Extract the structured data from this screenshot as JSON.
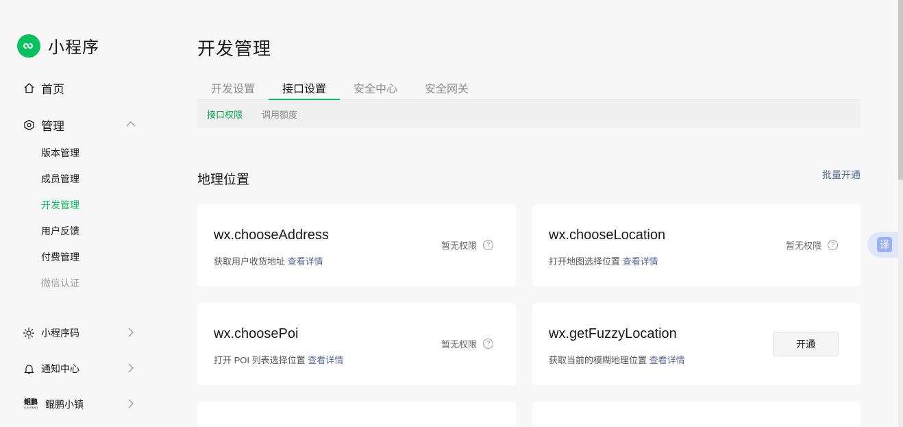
{
  "brand": {
    "name": "小程序",
    "logo_icon": "mini-program-logo"
  },
  "sidebar": {
    "home": "首页",
    "manage": "管理",
    "manage_sub": [
      "版本管理",
      "成员管理",
      "开发管理",
      "用户反馈",
      "付费管理",
      "微信认证"
    ],
    "miniprogram_code": "小程序码",
    "notification": "通知中心",
    "kunpeng": "鲲鹏小镇",
    "kunpeng_logo_text": "鲲鹏",
    "kunpeng_logo_sub": "YUN PENG"
  },
  "page": {
    "title": "开发管理"
  },
  "tabs": [
    "开发设置",
    "接口设置",
    "安全中心",
    "安全网关"
  ],
  "subtabs": [
    "接口权限",
    "调用额度"
  ],
  "section": {
    "title": "地理位置",
    "batch_open": "批量开通"
  },
  "cards": [
    {
      "name": "wx.chooseAddress",
      "desc": "获取用户收货地址",
      "link": "查看详情",
      "status": "暂无权限"
    },
    {
      "name": "wx.chooseLocation",
      "desc": "打开地图选择位置",
      "link": "查看详情",
      "status": "暂无权限"
    },
    {
      "name": "wx.choosePoi",
      "desc": "打开 POI 列表选择位置",
      "link": "查看详情",
      "status": "暂无权限"
    },
    {
      "name": "wx.getFuzzyLocation",
      "desc": "获取当前的模糊地理位置",
      "link": "查看详情",
      "button": "开通"
    }
  ],
  "help_glyph": "?",
  "translate_glyph": "译",
  "colors": {
    "accent": "#07c160",
    "link": "#576b95",
    "translate": "#9bb0f0"
  }
}
